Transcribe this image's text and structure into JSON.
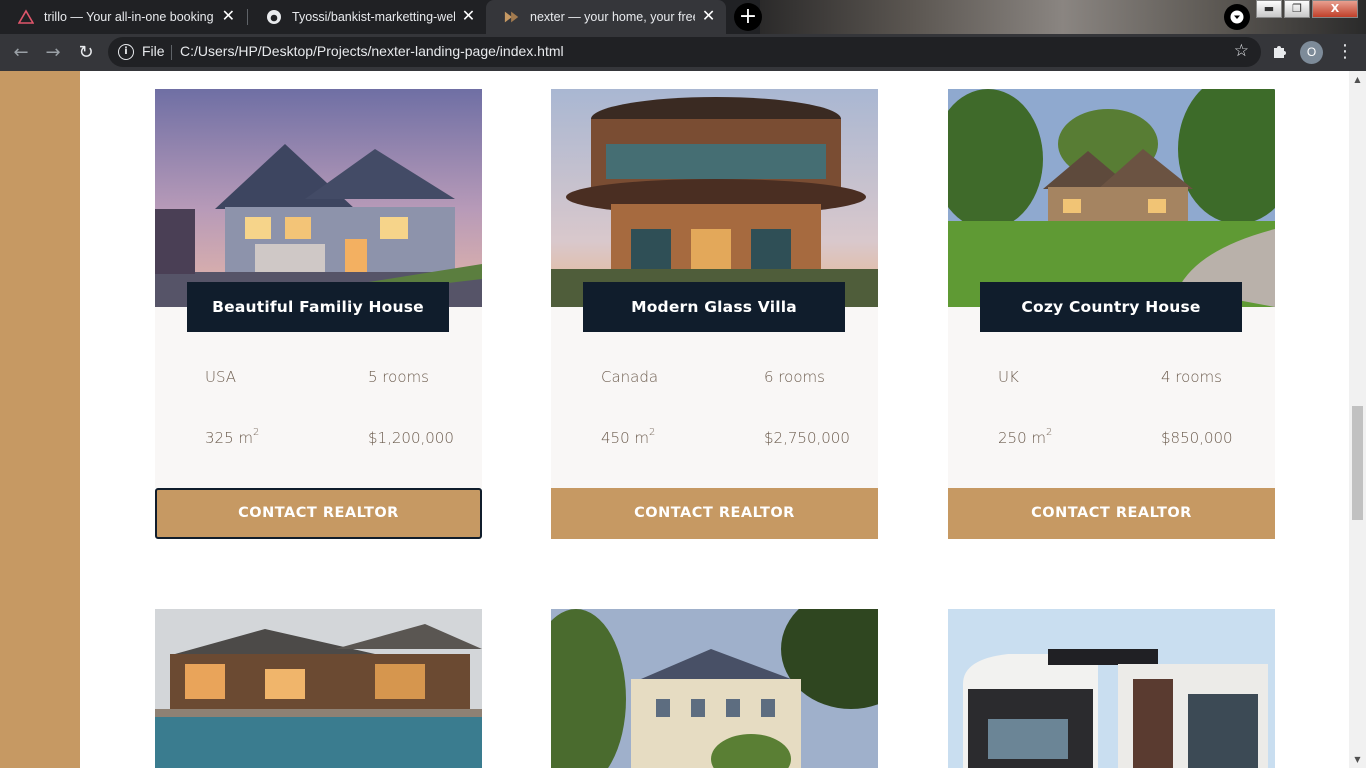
{
  "tabs": [
    {
      "title": "trillo — Your all-in-one booking app",
      "icon": "triangle-logo-icon"
    },
    {
      "title": "Tyossi/bankist-marketting-website",
      "icon": "github-icon"
    },
    {
      "title": "nexter — your home, your freedom",
      "icon": "nexter-logo-icon"
    }
  ],
  "window_buttons": {
    "minimize": "▬",
    "restore": "❐",
    "close": "X"
  },
  "address_bar": {
    "scheme_label": "File",
    "url": "C:/Users/HP/Desktop/Projects/nexter-landing-page/index.html"
  },
  "profile_initial": "O",
  "homes": [
    {
      "name": "Beautiful Familiy House",
      "location": "USA",
      "rooms": "5 rooms",
      "area": "325 m",
      "area_unit_exp": "2",
      "price": "$1,200,000",
      "cta": "CONTACT REALTOR"
    },
    {
      "name": "Modern Glass Villa",
      "location": "Canada",
      "rooms": "6 rooms",
      "area": "450 m",
      "area_unit_exp": "2",
      "price": "$2,750,000",
      "cta": "CONTACT REALTOR"
    },
    {
      "name": "Cozy Country House",
      "location": "UK",
      "rooms": "4 rooms",
      "area": "250 m",
      "area_unit_exp": "2",
      "price": "$850,000",
      "cta": "CONTACT REALTOR"
    }
  ],
  "colors": {
    "sidebar": "#c69963",
    "name_banner": "#101d2c",
    "card_body": "#f9f7f6",
    "detail_text": "#6d5d4f",
    "cta_bg": "#c69963"
  }
}
